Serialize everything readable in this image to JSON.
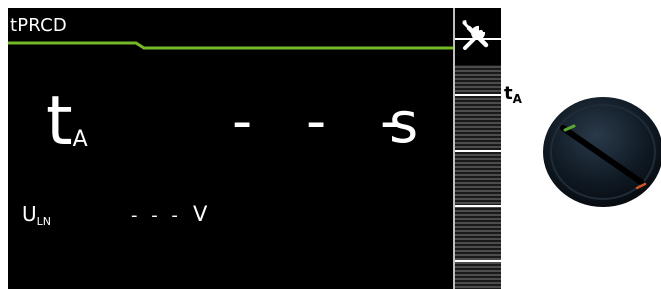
{
  "screen": {
    "mode_title": "tPRCD",
    "accent_color": "#76b82a"
  },
  "measurement": {
    "primary_symbol": "t",
    "primary_subscript": "A",
    "primary_value": "- - -",
    "primary_unit": "s",
    "secondary_symbol": "U",
    "secondary_subscript": "LN",
    "secondary_value": "- - -",
    "secondary_unit": "V"
  },
  "softkeys": {
    "top_icon": "tools-icon"
  },
  "rotary": {
    "label_symbol": "t",
    "label_subscript": "A",
    "knob_color": "#0d1520",
    "pointer_color": "#5aa83a",
    "mark_color": "#d1541e"
  }
}
